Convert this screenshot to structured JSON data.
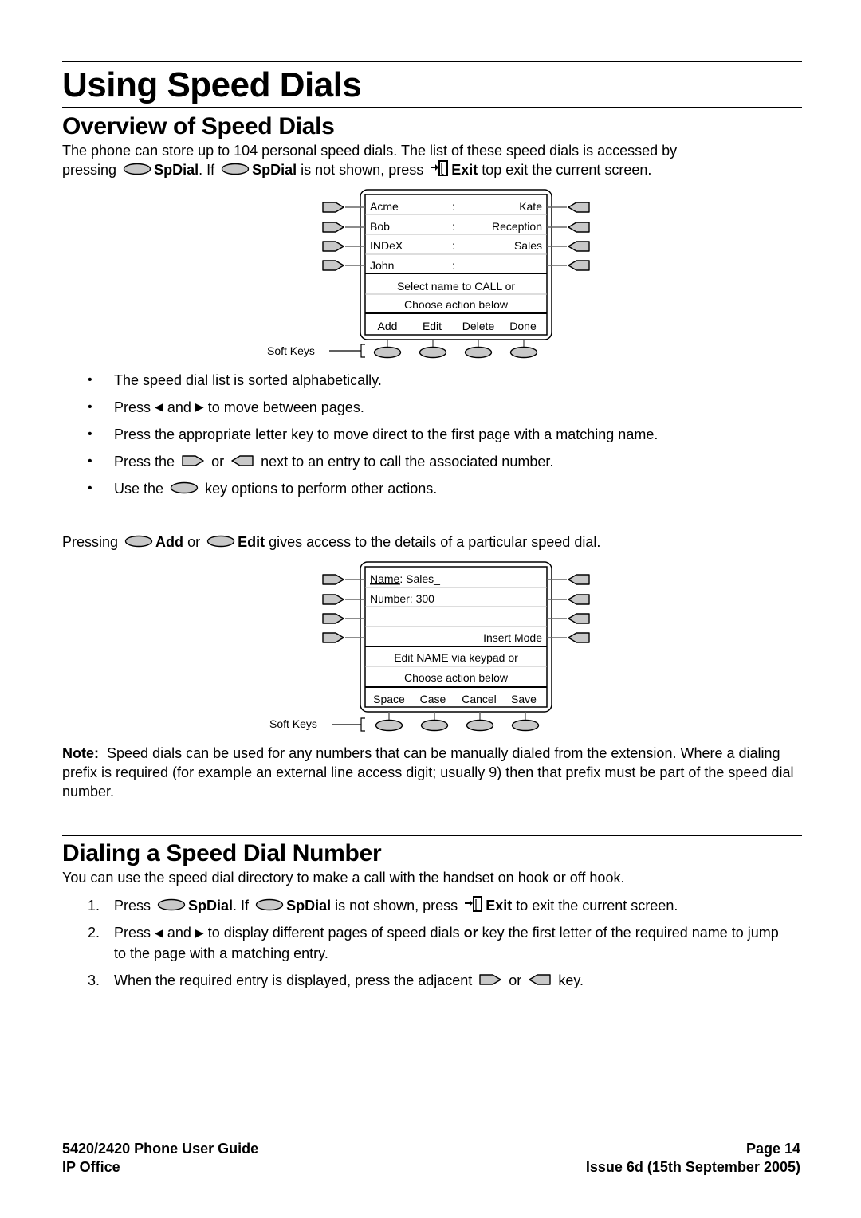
{
  "page_title": "Using Speed Dials",
  "section1": {
    "title": "Overview of Speed Dials",
    "intro_line1": "The phone can store up to 104 personal speed dials. The list of these speed dials is accessed by",
    "intro_l2_a": "pressing",
    "intro_l2_b": "SpDial",
    "intro_l2_c": ". If",
    "intro_l2_d": "SpDial",
    "intro_l2_e": "is not shown, press",
    "intro_l2_f": "Exit",
    "intro_l2_g": "top exit the current screen.",
    "screen1": {
      "rows": [
        {
          "left": "Acme",
          "sep": ":",
          "right": "Kate"
        },
        {
          "left": "Bob",
          "sep": ":",
          "right": "Reception"
        },
        {
          "left": "INDeX",
          "sep": ":",
          "right": "Sales"
        },
        {
          "left": "John",
          "sep": ":",
          "right": ""
        }
      ],
      "prompt1": "Select name to CALL or",
      "prompt2": "Choose action below",
      "softkeys": [
        "Add",
        "Edit",
        "Delete",
        "Done"
      ],
      "softkeys_label": "Soft Keys"
    },
    "bullets": {
      "b1": "The speed dial list is sorted alphabetically.",
      "b2_a": "Press",
      "b2_b": "and",
      "b2_c": "to move between pages.",
      "b3": "Press the appropriate letter key to move direct to the first page with a matching name.",
      "b4_a": "Press the",
      "b4_b": "or",
      "b4_c": "next to an entry to call the associated number.",
      "b5_a": "Use the",
      "b5_b": "key options to perform other actions."
    },
    "pressing_a": "Pressing",
    "pressing_b": "Add",
    "pressing_c": "or",
    "pressing_d": "Edit",
    "pressing_e": "gives access to the details of a particular speed dial.",
    "screen2": {
      "name_label": "Name",
      "name_value": ":  Sales_",
      "number_line": "Number: 300",
      "row3": "",
      "mode": "Insert Mode",
      "prompt1": "Edit NAME via keypad or",
      "prompt2": "Choose action below",
      "softkeys": [
        "Space",
        "Case",
        "Cancel",
        "Save"
      ],
      "softkeys_label": "Soft Keys"
    },
    "note_label": "Note:",
    "note_text": "Speed dials can be used for any numbers that can be manually dialed from the extension. Where a dialing prefix is required (for example an external line access digit; usually 9) then that prefix must be part of the speed dial number."
  },
  "section2": {
    "title": "Dialing a Speed Dial Number",
    "intro": "You can use the speed dial directory to make a call with the handset on hook or off hook.",
    "steps": {
      "s1_n": "1.",
      "s1_a": "Press",
      "s1_b": "SpDial",
      "s1_c": ". If",
      "s1_d": "SpDial",
      "s1_e": "is not shown, press",
      "s1_f": "Exit",
      "s1_g": "to exit the current screen.",
      "s2_n": "2.",
      "s2_a": "Press",
      "s2_b": "and",
      "s2_c": "to display different pages of speed dials",
      "s2_d": "or",
      "s2_e": "key the first letter of the required name to jump to the page with a matching entry.",
      "s3_n": "3.",
      "s3_a": "When the required entry is displayed, press the adjacent",
      "s3_b": "or",
      "s3_c": "key."
    }
  },
  "footer": {
    "left1": "5420/2420 Phone User Guide",
    "left2": "IP Office",
    "right1": "Page 14",
    "right2": "Issue 6d (15th September 2005)"
  },
  "icons": {
    "left_arrow": "◀",
    "right_arrow": "▶"
  }
}
